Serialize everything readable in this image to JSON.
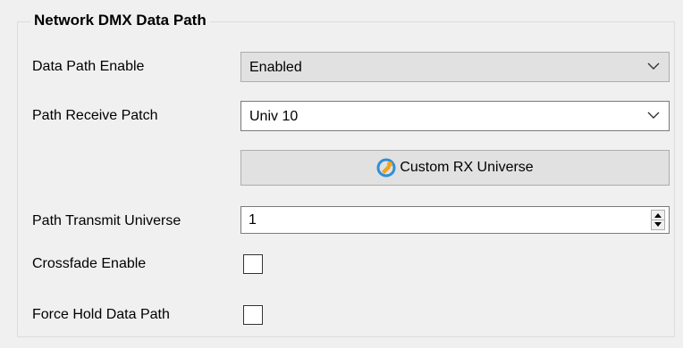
{
  "group": {
    "title": "Network DMX Data Path"
  },
  "rows": {
    "data_path_enable": {
      "label": "Data Path Enable",
      "value": "Enabled",
      "options_visible": [
        "Enabled"
      ]
    },
    "path_receive_patch": {
      "label": "Path Receive Patch",
      "value": "Univ 10"
    },
    "custom_rx_button": {
      "label": "Custom RX Universe",
      "icon": "gear-refresh-icon"
    },
    "path_transmit_universe": {
      "label": "Path Transmit Universe",
      "value": "1"
    },
    "crossfade_enable": {
      "label": "Crossfade Enable",
      "checked": false
    },
    "force_hold_data_path": {
      "label": "Force Hold Data Path",
      "checked": false
    }
  },
  "colors": {
    "window_bg": "#f0f0f0",
    "control_disabled_bg": "#e1e1e1",
    "icon_blue": "#2f8fd6",
    "icon_orange": "#f2a31b"
  }
}
